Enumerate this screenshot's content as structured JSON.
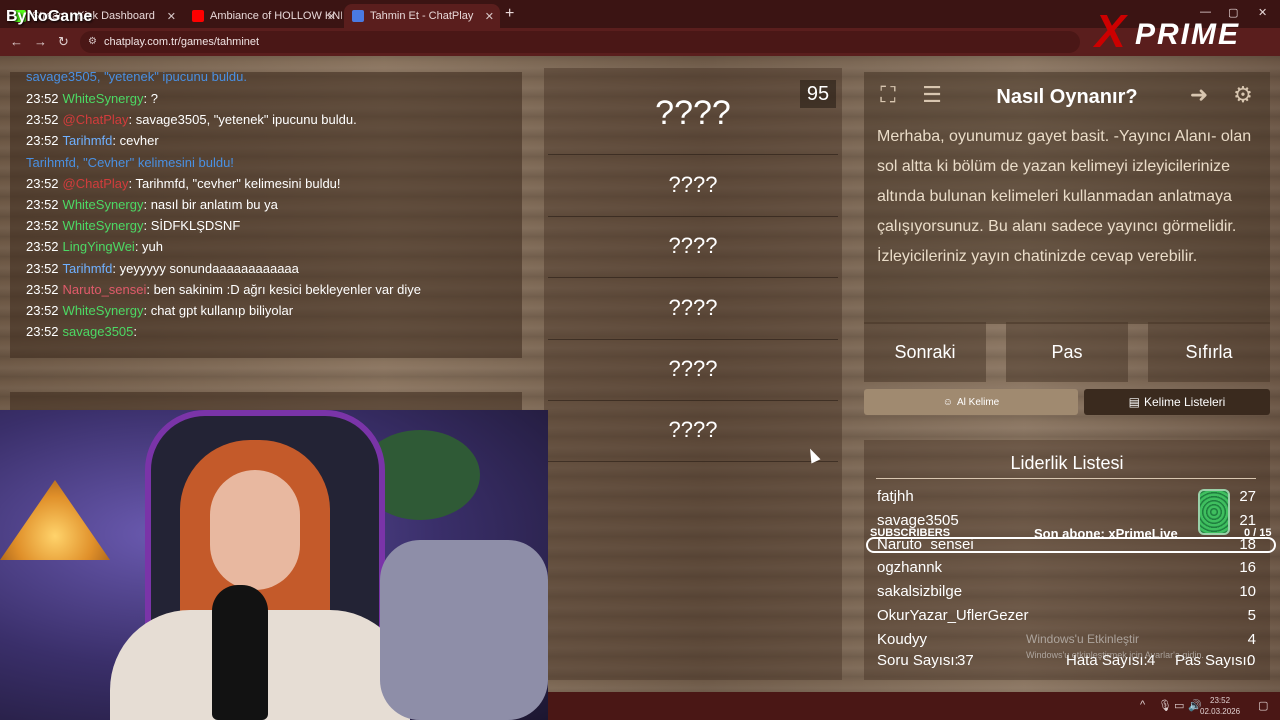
{
  "browser": {
    "tabs": [
      {
        "label": "Stream - Kick Dashboard",
        "color": "#53fc18"
      },
      {
        "label": "Ambiance of HOLLOW KNI",
        "color": "#ff0000"
      },
      {
        "label": "Tahmin Et - ChatPlay",
        "color": "#4a7ae2"
      }
    ],
    "url": "chatplay.com.tr/games/tahminet",
    "new_tab": "+",
    "back": "←",
    "forward": "→",
    "reload": "↻"
  },
  "overlay": {
    "channel_logo": "ByNoGame",
    "brand_x": "X",
    "brand_name": "PRIME"
  },
  "chat": {
    "partial_top": "savage3505, \"yetenek\" ipucunu buldu.",
    "partial_top_prefix": "savage3505, ",
    "messages": [
      {
        "time": "23:52",
        "user": "WhiteSynergy",
        "user_color": "#4cd964",
        "text": ": ?"
      },
      {
        "time": "23:52",
        "user": "@ChatPlay",
        "user_color": "#d23c3c",
        "text": ": savage3505, \"yetenek\" ipucunu buldu."
      },
      {
        "time": "23:52",
        "user": "Tarihmfd",
        "user_color": "#6fb0ff",
        "text": ": cevher"
      },
      {
        "time": "",
        "user": "Tarihmfd, \"Cevher\" kelimesini buldu!",
        "user_color": "#4a90e2",
        "text": ""
      },
      {
        "time": "23:52",
        "user": "@ChatPlay",
        "user_color": "#d23c3c",
        "text": ": Tarihmfd, \"cevher\" kelimesini buldu!"
      },
      {
        "time": "23:52",
        "user": "WhiteSynergy",
        "user_color": "#4cd964",
        "text": ": nasıl bir anlatım bu ya"
      },
      {
        "time": "23:52",
        "user": "WhiteSynergy",
        "user_color": "#4cd964",
        "text": ": SİDFKLŞDSNF"
      },
      {
        "time": "23:52",
        "user": "LingYingWei",
        "user_color": "#4cd964",
        "text": ": yuh"
      },
      {
        "time": "23:52",
        "user": "Tarihmfd",
        "user_color": "#6fb0ff",
        "text": ": yeyyyyy sonundaaaaaaaaaaaa"
      },
      {
        "time": "23:52",
        "user": "Naruto_sensei",
        "user_color": "#e05a6a",
        "text": ": ben sakinim :D ağrı kesici bekleyenler var diye"
      },
      {
        "time": "23:52",
        "user": "WhiteSynergy",
        "user_color": "#4cd964",
        "text": ": chat gpt kullanıp biliyolar"
      },
      {
        "time": "23:52",
        "user": "savage3505",
        "user_color": "#4cd964",
        "text": ":"
      }
    ]
  },
  "game": {
    "timer": "95",
    "words": [
      "????",
      "????",
      "????",
      "????",
      "????",
      "????"
    ]
  },
  "howto": {
    "title": "Nasıl Oynanır?",
    "text": "Merhaba, oyunumuz gayet basit. -Yayıncı Alanı- olan sol altta ki bölüm de yazan kelimeyi izleyicilerinize altında bulunan kelimeleri kullanmadan anlatmaya çalışıyorsunuz. Bu alanı sadece yayıncı görmelidir. İzleyicileriniz yayın chatinizde cevap verebilir."
  },
  "controls": {
    "next": "Sonraki",
    "pass": "Pas",
    "reset": "Sıfırla",
    "ai_word": "Al Kelime",
    "word_lists": "Kelime Listeleri"
  },
  "leaderboard": {
    "title": "Liderlik Listesi",
    "rows": [
      {
        "name": "fatjhh",
        "score": "27"
      },
      {
        "name": "savage3505",
        "score": "21"
      },
      {
        "name": "Naruto_sensei",
        "score": "18"
      },
      {
        "name": "ogzhannk",
        "score": "16"
      },
      {
        "name": "sakalsizbilge",
        "score": "10"
      },
      {
        "name": "OkurYazar_UflerGezer",
        "score": "5"
      },
      {
        "name": "Koudyy",
        "score": "4"
      }
    ],
    "question_count_label": "Soru Sayısı:",
    "question_count": "37",
    "error_count_label": "Hata Sayısı:",
    "error_count": "4",
    "pass_count_label": "Pas Sayısı:",
    "pass_count": "0"
  },
  "subscribers": {
    "label": "SUBSCRIBERS",
    "last_sub": "Son abone: xPrimeLive",
    "goal": "0 / 15"
  },
  "windows": {
    "activate_title": "Windows'u Etkinleştir",
    "activate_sub": "Windows'u etkinleştirmek için Ayarlar'a gidin.",
    "time": "23:52",
    "date": "02.03.2026"
  }
}
